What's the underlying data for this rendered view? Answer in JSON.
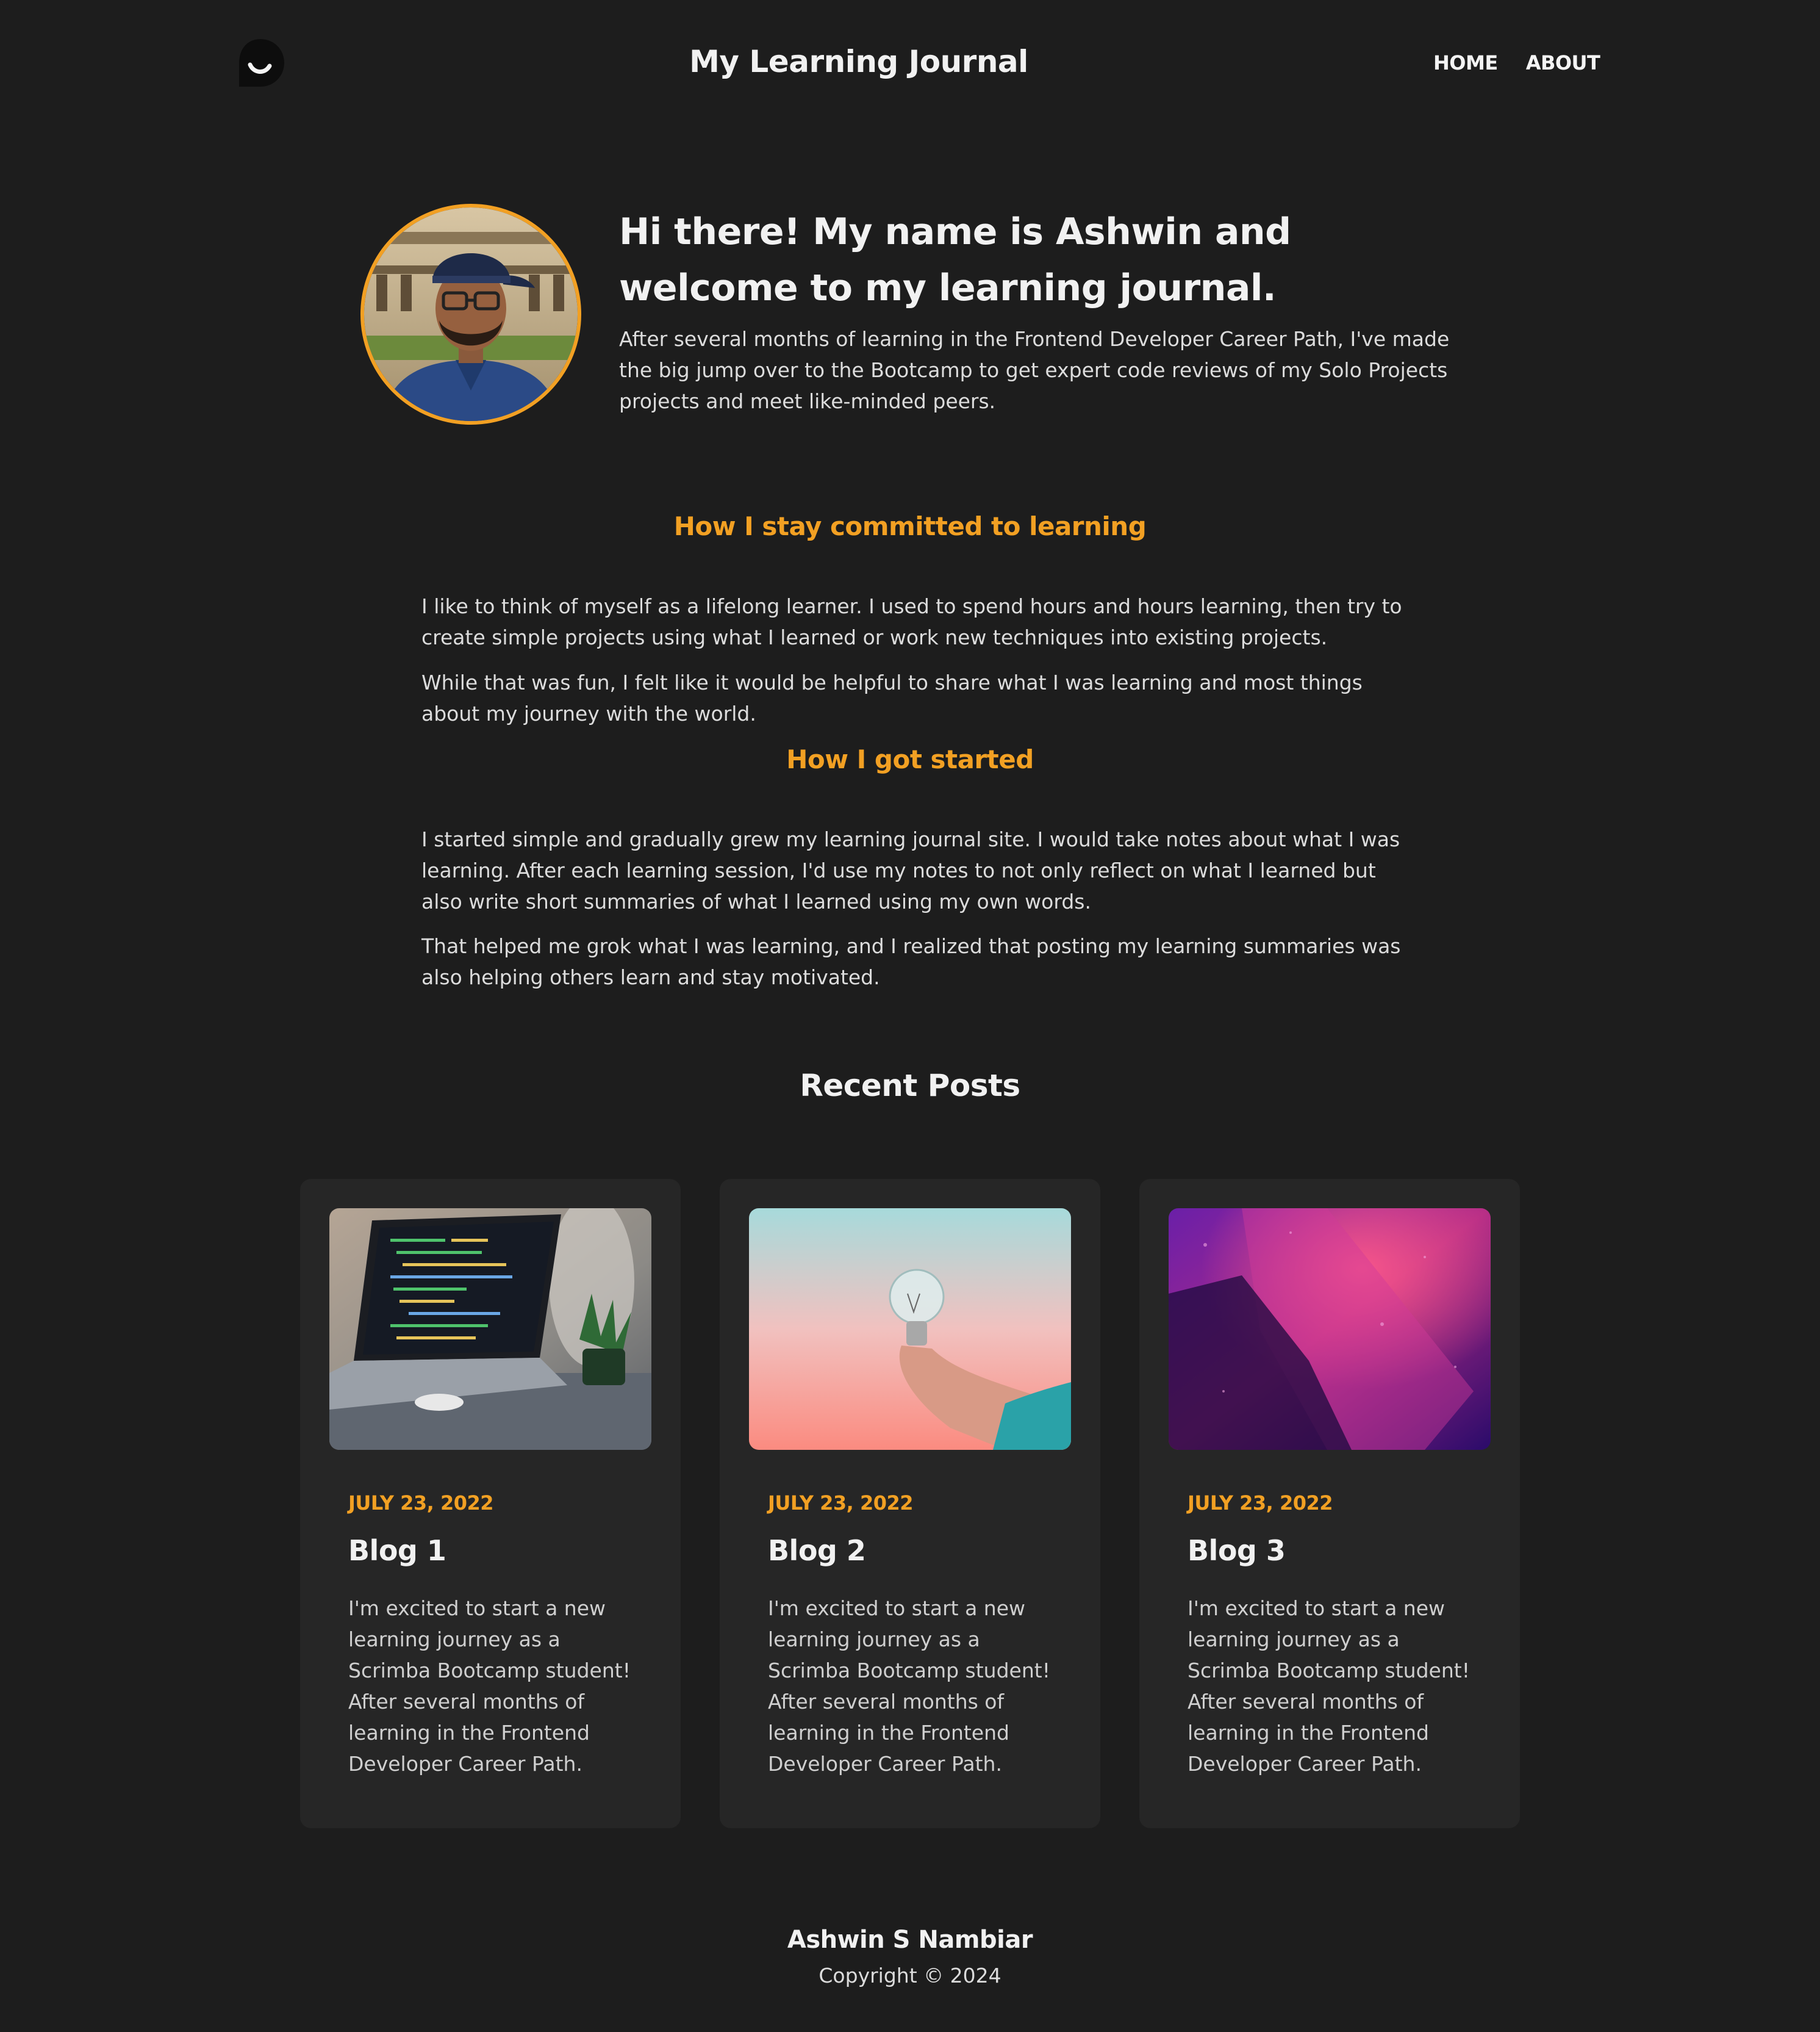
{
  "header": {
    "title": "My Learning Journal",
    "nav": [
      "HOME",
      "ABOUT"
    ]
  },
  "hero": {
    "heading": "Hi there! My name is Ashwin and welcome to my learning journal.",
    "text": "After several months of learning in the Frontend Developer Career Path, I've made the big jump over to the Bootcamp to get expert code reviews of my Solo Projects projects and meet like-minded peers."
  },
  "sections": [
    {
      "title": "How I stay committed to learning",
      "paragraphs": [
        "I like to think of myself as a lifelong learner. I used to spend hours and hours learning, then try to create simple projects using what I learned or work new techniques into existing projects.",
        "While that was fun, I felt like it would be helpful to share what I was learning and most things about my journey with the world."
      ]
    },
    {
      "title": "How I got started",
      "paragraphs": [
        "I started simple and gradually grew my learning journal site. I would take notes about what I was learning. After each learning session, I'd use my notes to not only reflect on what I learned but also write short summaries of what I learned using my own words.",
        "That helped me grok what I was learning, and I realized that posting my learning summaries was also helping others learn and stay motivated."
      ]
    }
  ],
  "recent": {
    "title": "Recent Posts",
    "posts": [
      {
        "date": "JULY 23, 2022",
        "title": "Blog 1",
        "text": "I'm excited to start a new learning journey as a Scrimba Bootcamp student! After several months of learning in the Frontend Developer Career Path."
      },
      {
        "date": "JULY 23, 2022",
        "title": "Blog 2",
        "text": "I'm excited to start a new learning journey as a Scrimba Bootcamp student! After several months of learning in the Frontend Developer Career Path."
      },
      {
        "date": "JULY 23, 2022",
        "title": "Blog 3",
        "text": "I'm excited to start a new learning journey as a Scrimba Bootcamp student! After several months of learning in the Frontend Developer Career Path."
      }
    ]
  },
  "footer": {
    "name": "Ashwin S Nambiar",
    "copyright": "Copyright © 2024"
  },
  "colors": {
    "background": "#1d1d1d",
    "card": "#262626",
    "accent": "#f2a023",
    "text": "#e9e9e9"
  }
}
